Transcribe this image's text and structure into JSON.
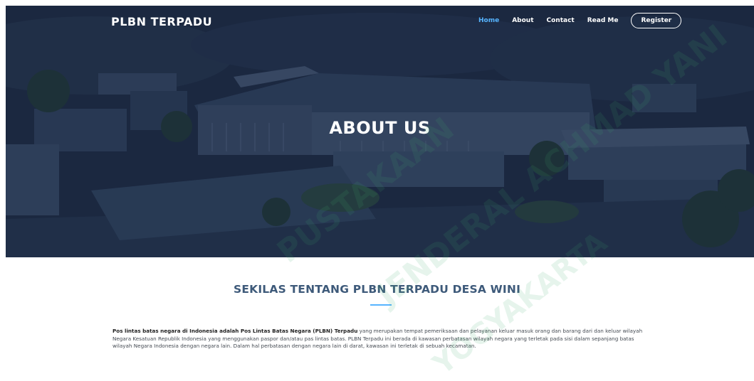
{
  "header": {
    "logo": "PLBN TERPADU",
    "nav": [
      {
        "label": "Home",
        "active": true
      },
      {
        "label": "About",
        "active": false
      },
      {
        "label": "Contact",
        "active": false
      },
      {
        "label": "Read Me",
        "active": false
      }
    ],
    "register_label": "Register"
  },
  "hero": {
    "title": "ABOUT US"
  },
  "section": {
    "title": "SEKILAS TENTANG PLBN TERPADU DESA WINI",
    "paragraph_bold_1": "Pos lintas batas negara di Indonesia adalah Pos Lintas Batas Negara (PLBN) Terpadu",
    "paragraph_rest": " yang merupakan tempat pemeriksaan dan pelayanan keluar masuk orang dan barang dari dan keluar wilayah Negara Kesatuan Republik Indonesia yang menggunakan paspor dan/atau pas lintas batas. PLBN Terpadu ini berada di kawasan perbatasan wilayah negara yang terletak pada sisi dalam sepanjang batas wilayah Negara Indonesia dengan negara lain. Dalam hal perbatasan dengan negara lain di darat, kawasan ini terletak di sebuah kecamatan."
  },
  "watermark": [
    "PUSTAKAAN",
    "JENDERAL ACHMAD YANI",
    "YOGYAKARTA"
  ],
  "colors": {
    "accent": "#56b4ff",
    "section_title": "#3e5a7a",
    "hero_overlay": "#1d2a42"
  }
}
